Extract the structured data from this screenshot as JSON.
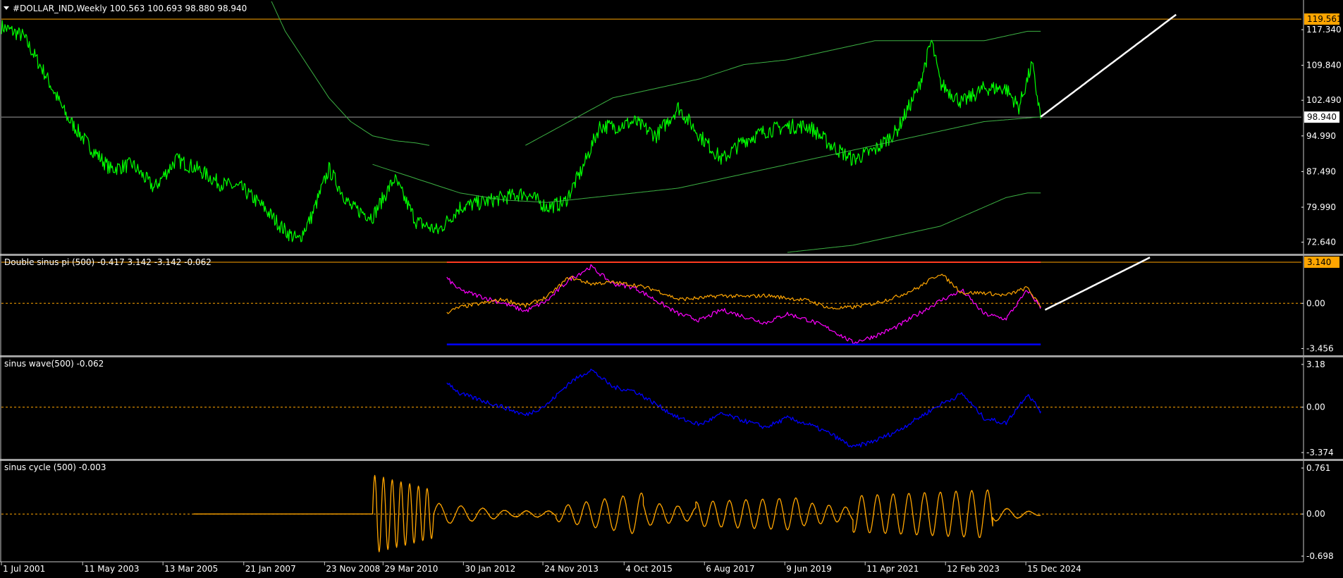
{
  "colors": {
    "background": "#000000",
    "price": "#00ff00",
    "envelope": "#3cb043",
    "level": "#ffa500",
    "level_label_bg": "#ffa500",
    "current_label_bg": "#ffffff",
    "sin_a": "#ff00ff",
    "sin_b": "#ffa500",
    "upper_band": "#ff3b1f",
    "lower_band": "#0000ff",
    "wave": "#0000ff",
    "cycle": "#ffa500",
    "projection": "#ffffff",
    "zero_line": "#ffa500",
    "axis_text": "#ffffff"
  },
  "chart_data": [
    {
      "type": "line",
      "title": "#DOLLAR_IND,Weekly  100.563 100.693 98.880 98.940",
      "symbol": "#DOLLAR_IND",
      "timeframe": "Weekly",
      "ohlc": {
        "open": 100.563,
        "high": 100.693,
        "low": 98.88,
        "close": 98.94
      },
      "y_ticks": [
        "117.340",
        "109.840",
        "102.490",
        "94.990",
        "87.490",
        "79.990",
        "72.640"
      ],
      "ylim": [
        70.5,
        121.5
      ],
      "level_line": {
        "value": 119.561,
        "label": "119.561"
      },
      "current_line": {
        "value": 98.94,
        "label": "98.940"
      },
      "series": [
        {
          "key": "price",
          "x": [
            2001.5,
            2002.0,
            2002.5,
            2003.0,
            2003.5,
            2004.0,
            2004.5,
            2005.0,
            2005.5,
            2006.0,
            2006.5,
            2007.0,
            2007.5,
            2008.0,
            2008.3,
            2008.6,
            2009.0,
            2009.5,
            2010.0,
            2010.5,
            2011.0,
            2011.5,
            2012.0,
            2012.5,
            2013.0,
            2013.5,
            2014.0,
            2014.4,
            2014.8,
            2015.2,
            2015.6,
            2016.0,
            2016.5,
            2017.0,
            2017.5,
            2018.0,
            2018.5,
            2019.0,
            2019.5,
            2020.0,
            2020.5,
            2021.0,
            2021.5,
            2022.0,
            2022.5,
            2022.8,
            2023.0,
            2023.5,
            2024.0,
            2024.5,
            2024.8,
            2025.1,
            2025.3
          ],
          "y": [
            118,
            116,
            108,
            99,
            93,
            88,
            89,
            84,
            90,
            88,
            85,
            84,
            80,
            75,
            73,
            78,
            88,
            80,
            78,
            86,
            77,
            75,
            80,
            81,
            82,
            83,
            80,
            81,
            88,
            97,
            97,
            98,
            95,
            101,
            95,
            90,
            94,
            96,
            97,
            97,
            93,
            90,
            92,
            96,
            105,
            115,
            106,
            102,
            105,
            105,
            101,
            110,
            99
          ]
        },
        {
          "key": "envelope_upper_left",
          "x": [
            2007.3,
            2007.6,
            2008.0,
            2008.5,
            2009.0,
            2009.5,
            2010.0,
            2010.5,
            2011.0,
            2011.3
          ],
          "y": [
            130,
            125,
            117,
            110,
            103,
            98,
            95,
            94,
            93.5,
            93
          ]
        },
        {
          "key": "envelope_mid",
          "x": [
            2010.0,
            2011.0,
            2012.0,
            2013.0,
            2014.0,
            2015.0,
            2016.0,
            2017.0,
            2018.0,
            2019.0,
            2020.0,
            2021.0,
            2022.0,
            2023.0,
            2024.0,
            2025.3
          ],
          "y": [
            89,
            86,
            83,
            81.5,
            81,
            82,
            83,
            84,
            86,
            88,
            90,
            92,
            94,
            96,
            98,
            99
          ]
        },
        {
          "key": "envelope_upper",
          "x": [
            2013.5,
            2014.5,
            2015.5,
            2016.5,
            2017.5,
            2018.5,
            2019.5,
            2020.5,
            2021.0,
            2021.5,
            2022.0,
            2022.5,
            2023.0,
            2023.5,
            2024.0,
            2024.5,
            2025.0,
            2025.3
          ],
          "y": [
            93,
            98,
            103,
            105,
            107,
            110,
            111,
            113,
            114,
            115,
            115,
            115,
            115,
            115,
            115,
            116,
            117,
            117
          ]
        },
        {
          "key": "envelope_lower",
          "x": [
            2019.5,
            2020.0,
            2020.5,
            2021.0,
            2021.5,
            2022.0,
            2022.5,
            2023.0,
            2023.5,
            2024.0,
            2024.5,
            2025.0,
            2025.3
          ],
          "y": [
            70.5,
            71,
            71.5,
            72,
            73,
            74,
            75,
            76,
            78,
            80,
            82,
            83,
            83
          ]
        },
        {
          "key": "projection",
          "x": [
            2025.3,
            2028.4
          ],
          "y": [
            99,
            120.5
          ]
        }
      ]
    },
    {
      "type": "line",
      "title": "Double sinus pi (500) -0.417 3.142 -3.142 -0.062",
      "y_ticks": [
        "0.00",
        "-3.456"
      ],
      "ylim": [
        -3.7,
        3.3
      ],
      "level_line": {
        "value": 3.14,
        "label": "3.140"
      },
      "zero_line": 0,
      "series": [
        {
          "key": "sin_a",
          "x": [
            2011.7,
            2012.0,
            2012.5,
            2013.0,
            2013.5,
            2014.0,
            2014.5,
            2015.0,
            2015.5,
            2016.0,
            2016.5,
            2017.0,
            2017.5,
            2018.0,
            2018.5,
            2019.0,
            2019.5,
            2020.0,
            2020.5,
            2021.0,
            2021.5,
            2022.0,
            2022.5,
            2023.0,
            2023.5,
            2024.0,
            2024.5,
            2025.0,
            2025.3
          ],
          "y": [
            1.9,
            1.0,
            0.5,
            0.0,
            -0.6,
            0.2,
            1.8,
            2.8,
            1.5,
            1.2,
            0.2,
            -0.8,
            -1.3,
            -0.5,
            -1.0,
            -1.5,
            -0.8,
            -1.3,
            -2.0,
            -3.0,
            -2.5,
            -1.8,
            -0.8,
            0.2,
            1.0,
            -0.8,
            -1.2,
            1.0,
            -0.3
          ]
        },
        {
          "key": "sin_b",
          "x": [
            2011.7,
            2012.0,
            2012.5,
            2013.0,
            2013.5,
            2014.0,
            2014.5,
            2015.0,
            2015.5,
            2016.0,
            2016.5,
            2017.0,
            2017.5,
            2018.0,
            2018.5,
            2019.0,
            2019.5,
            2020.0,
            2020.5,
            2021.0,
            2021.5,
            2022.0,
            2022.5,
            2023.0,
            2023.5,
            2024.0,
            2024.5,
            2025.0,
            2025.3
          ],
          "y": [
            -0.7,
            -0.3,
            0.0,
            0.3,
            -0.2,
            0.5,
            2.0,
            1.5,
            1.6,
            1.4,
            1.0,
            0.3,
            0.4,
            0.6,
            0.5,
            0.6,
            0.4,
            0.2,
            -0.4,
            -0.3,
            0.0,
            0.5,
            1.2,
            2.3,
            0.8,
            0.8,
            0.6,
            1.2,
            -0.3
          ]
        },
        {
          "key": "upper_band",
          "x": [
            2011.7,
            2025.3
          ],
          "y": [
            3.14,
            3.14
          ]
        },
        {
          "key": "lower_band",
          "x": [
            2011.7,
            2025.3
          ],
          "y": [
            -3.14,
            -3.14
          ]
        },
        {
          "key": "projection",
          "x": [
            2025.4,
            2027.8
          ],
          "y": [
            -0.5,
            3.5
          ]
        }
      ]
    },
    {
      "type": "line",
      "title": "sinus wave(500) -0.062",
      "y_ticks": [
        "3.18",
        "0.00",
        "-3.374"
      ],
      "ylim": [
        -3.374,
        3.18
      ],
      "zero_line": 0,
      "series": [
        {
          "key": "wave",
          "x": [
            2011.7,
            2012.0,
            2012.5,
            2013.0,
            2013.5,
            2014.0,
            2014.5,
            2015.0,
            2015.5,
            2016.0,
            2016.5,
            2017.0,
            2017.5,
            2018.0,
            2018.5,
            2019.0,
            2019.5,
            2020.0,
            2020.5,
            2021.0,
            2021.5,
            2022.0,
            2022.5,
            2023.0,
            2023.5,
            2024.0,
            2024.5,
            2025.0,
            2025.3
          ],
          "y": [
            1.9,
            1.0,
            0.5,
            0.0,
            -0.6,
            0.2,
            1.8,
            2.8,
            1.5,
            1.2,
            0.2,
            -0.8,
            -1.3,
            -0.5,
            -1.0,
            -1.5,
            -0.8,
            -1.3,
            -2.0,
            -3.0,
            -2.5,
            -1.8,
            -0.8,
            0.2,
            1.0,
            -0.8,
            -1.2,
            1.0,
            -0.3
          ]
        }
      ]
    },
    {
      "type": "line",
      "title": "sinus cycle (500) -0.003",
      "y_ticks": [
        "0.761",
        "0.00",
        "-0.698"
      ],
      "ylim": [
        -0.698,
        0.761
      ],
      "zero_line": 0,
      "cycle": {
        "flat_from": 2005.9,
        "start": 2010.0,
        "end": 2025.3,
        "segments": [
          {
            "from": 2010.0,
            "to": 2011.4,
            "period": 0.2,
            "amp": [
              0.65,
              0.4
            ]
          },
          {
            "from": 2011.4,
            "to": 2013.3,
            "period": 0.5,
            "amp": [
              0.18,
              0.04
            ]
          },
          {
            "from": 2013.3,
            "to": 2014.2,
            "period": 0.5,
            "amp": [
              0.05,
              0.05
            ]
          },
          {
            "from": 2014.2,
            "to": 2016.2,
            "period": 0.42,
            "amp": [
              0.12,
              0.35
            ]
          },
          {
            "from": 2016.2,
            "to": 2017.4,
            "period": 0.42,
            "amp": [
              0.2,
              0.1
            ]
          },
          {
            "from": 2017.4,
            "to": 2019.8,
            "period": 0.38,
            "amp": [
              0.2,
              0.27
            ]
          },
          {
            "from": 2019.8,
            "to": 2021.0,
            "period": 0.38,
            "amp": [
              0.2,
              0.1
            ]
          },
          {
            "from": 2021.0,
            "to": 2024.2,
            "period": 0.36,
            "amp": [
              0.3,
              0.4
            ]
          },
          {
            "from": 2024.2,
            "to": 2025.3,
            "period": 0.5,
            "amp": [
              0.12,
              0.02
            ]
          }
        ]
      }
    }
  ],
  "x_axis": {
    "xlim": [
      2001.5,
      2031.27
    ],
    "ticks": [
      {
        "label": "1 Jul 2001",
        "x": 2001.5
      },
      {
        "label": "11 May 2003",
        "x": 2003.36
      },
      {
        "label": "13 Mar 2005",
        "x": 2005.2
      },
      {
        "label": "21 Jan 2007",
        "x": 2007.05
      },
      {
        "label": "23 Nov 2008",
        "x": 2008.9
      },
      {
        "label": "29 Mar 2010",
        "x": 2010.24
      },
      {
        "label": "30 Jan 2012",
        "x": 2012.08
      },
      {
        "label": "24 Nov 2013",
        "x": 2013.9
      },
      {
        "label": "4 Oct 2015",
        "x": 2015.76
      },
      {
        "label": "6 Aug 2017",
        "x": 2017.6
      },
      {
        "label": "9 Jun 2019",
        "x": 2019.44
      },
      {
        "label": "11 Apr 2021",
        "x": 2021.28
      },
      {
        "label": "12 Feb 2023",
        "x": 2023.12
      },
      {
        "label": "15 Dec 2024",
        "x": 2024.96
      }
    ]
  }
}
